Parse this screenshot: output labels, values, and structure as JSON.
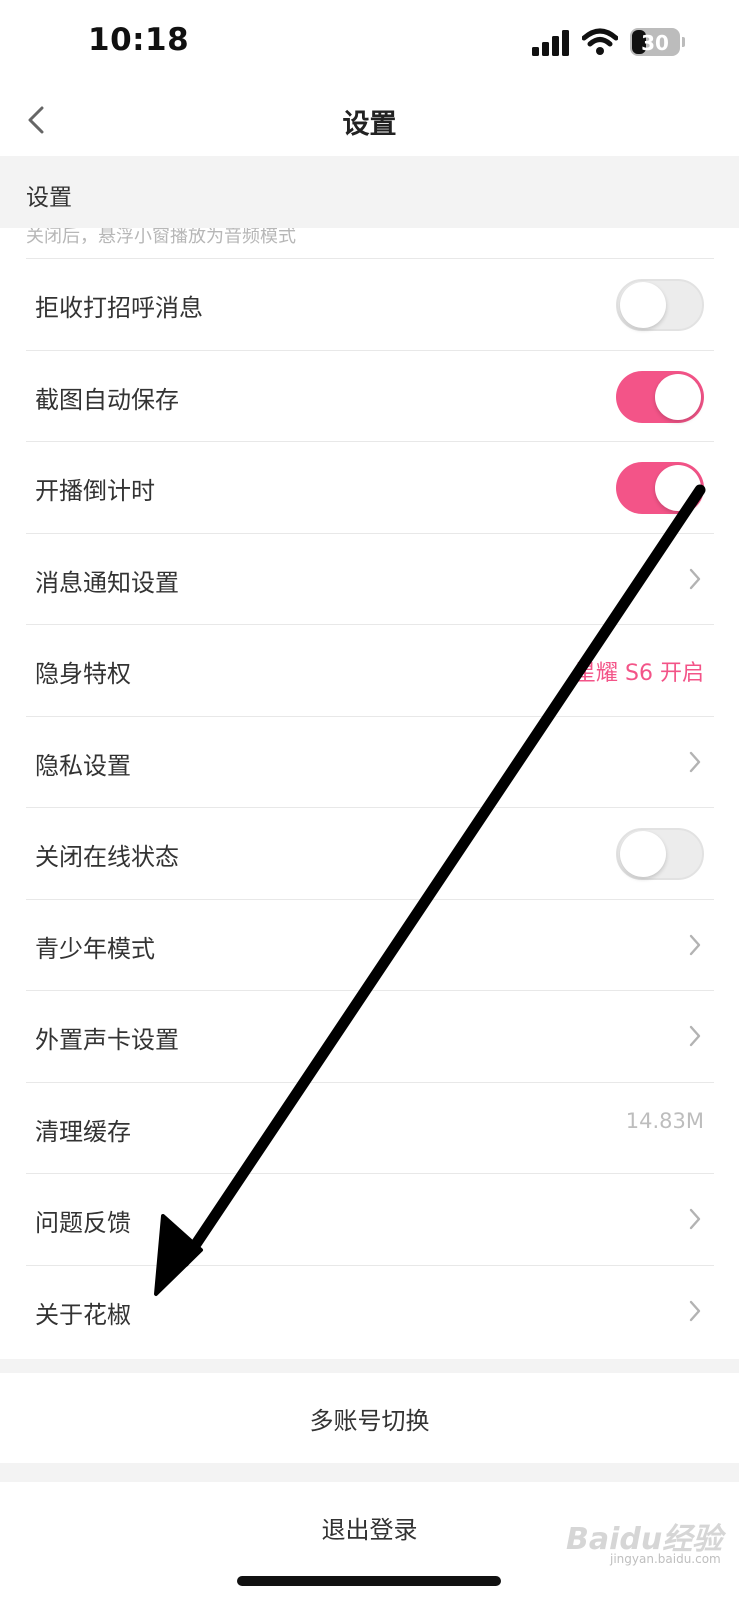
{
  "status_bar": {
    "time": "10:18",
    "battery": "30",
    "battery_level": 0.3
  },
  "nav": {
    "title": "设置"
  },
  "section": {
    "title": "设置",
    "hint": "关闭后，悬浮小窗播放为音频模式"
  },
  "settings": [
    {
      "label": "拒收打招呼消息",
      "control": "toggle",
      "on": false
    },
    {
      "label": "截图自动保存",
      "control": "toggle",
      "on": true
    },
    {
      "label": "开播倒计时",
      "control": "toggle",
      "on": true
    },
    {
      "label": "消息通知设置",
      "control": "chevron"
    },
    {
      "label": "隐身特权",
      "control": "value",
      "value": "星耀 S6 开启"
    },
    {
      "label": "隐私设置",
      "control": "chevron"
    },
    {
      "label": "关闭在线状态",
      "control": "toggle",
      "on": false
    },
    {
      "label": "青少年模式",
      "control": "chevron"
    },
    {
      "label": "外置声卡设置",
      "control": "chevron"
    },
    {
      "label": "清理缓存",
      "control": "value",
      "value": "14.83M"
    },
    {
      "label": "问题反馈",
      "control": "chevron"
    },
    {
      "label": "关于花椒",
      "control": "chevron"
    }
  ],
  "actions": {
    "switch_account": "多账号切换",
    "logout": "退出登录"
  },
  "watermark": {
    "brand": "Baidu经验",
    "url": "jingyan.baidu.com"
  },
  "colors": {
    "accent": "#f35488",
    "toggle_off": "#ececec",
    "background": "#f3f3f3"
  }
}
